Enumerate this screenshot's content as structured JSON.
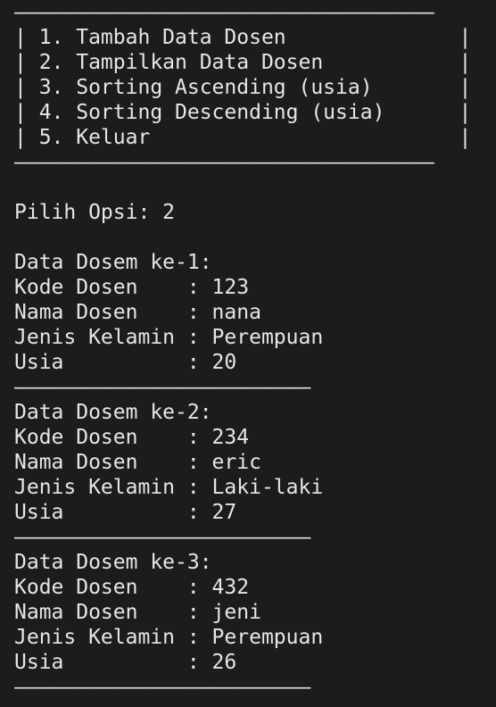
{
  "menu": {
    "border": "——————————————————————————————————",
    "items": [
      "| 1. Tambah Data Dosen              |",
      "| 2. Tampilkan Data Dosen           |",
      "| 3. Sorting Ascending (usia)       |",
      "| 4. Sorting Descending (usia)      |",
      "| 5. Keluar                         |"
    ]
  },
  "prompt": "Pilih Opsi: 2",
  "separator": "————————————————————————",
  "records": [
    {
      "header": "Data Dosem ke-1:",
      "kode": "Kode Dosen    : 123",
      "nama": "Nama Dosen    : nana",
      "jenis": "Jenis Kelamin : Perempuan",
      "usia": "Usia          : 20"
    },
    {
      "header": "Data Dosem ke-2:",
      "kode": "Kode Dosen    : 234",
      "nama": "Nama Dosen    : eric",
      "jenis": "Jenis Kelamin : Laki-laki",
      "usia": "Usia          : 27"
    },
    {
      "header": "Data Dosem ke-3:",
      "kode": "Kode Dosen    : 432",
      "nama": "Nama Dosen    : jeni",
      "jenis": "Jenis Kelamin : Perempuan",
      "usia": "Usia          : 26"
    }
  ],
  "colors": {
    "background": "#1c1c1c",
    "text": "#e6e6e6"
  }
}
